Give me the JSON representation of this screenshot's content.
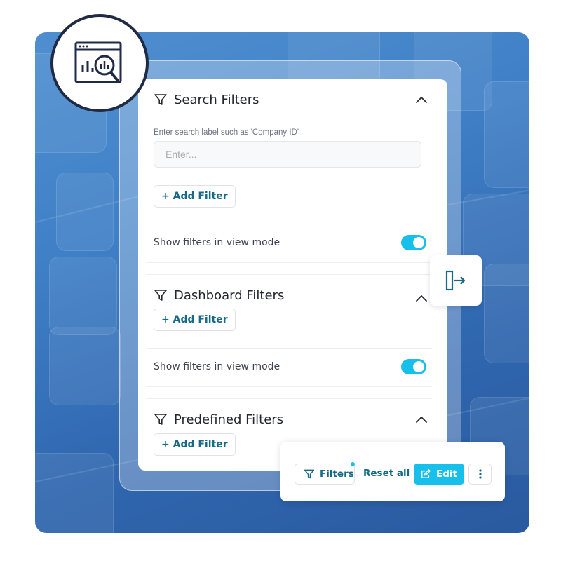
{
  "sections": [
    {
      "title": "Search Filters",
      "field_label": "Enter search label such as 'Company ID'",
      "input_placeholder": "Enter...",
      "input_value": "",
      "add_filter_label": "+ Add Filter",
      "toggle_label": "Show filters in view mode",
      "toggle_on": true
    },
    {
      "title": "Dashboard Filters",
      "add_filter_label": "+ Add Filter",
      "toggle_label": "Show filters in view mode",
      "toggle_on": true
    },
    {
      "title": "Predefined Filters",
      "add_filter_label": "+ Add Filter"
    }
  ],
  "toolbar": {
    "filters_label": "Filters",
    "reset_label": "Reset all",
    "edit_label": "Edit"
  },
  "icons": {
    "logo": "analytics-search-icon",
    "section": "funnel-icon",
    "collapse": "chevron-up-icon",
    "side": "panel-expand-icon",
    "edit": "pencil-icon",
    "more": "kebab-menu-icon"
  },
  "colors": {
    "accent": "#17c0ea",
    "link_text": "#166a86",
    "background": "#3f7fc6",
    "logo_ring": "#1f2a44"
  }
}
